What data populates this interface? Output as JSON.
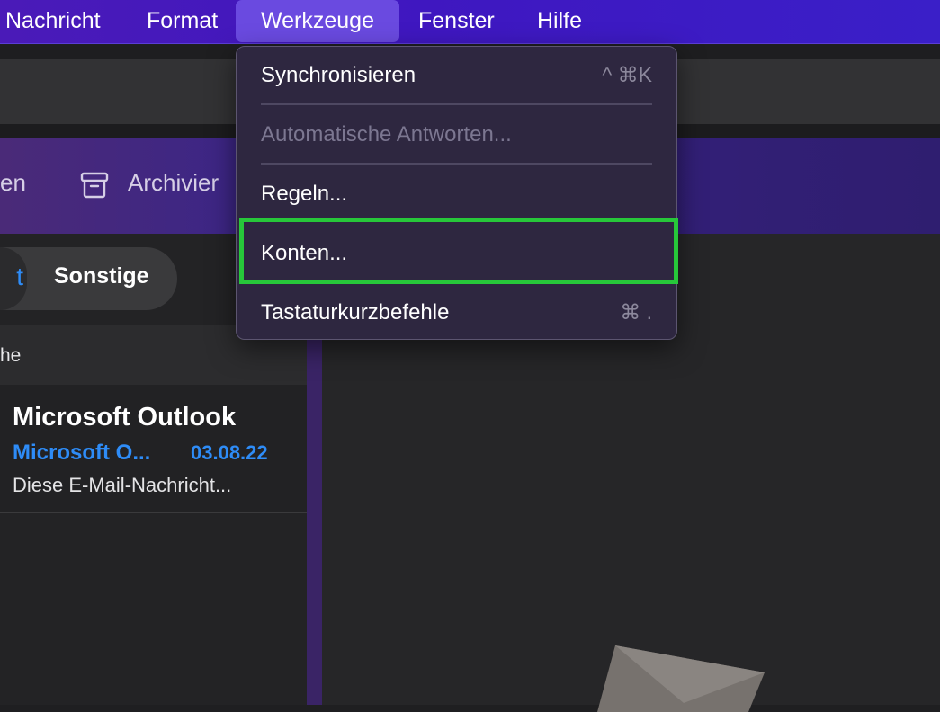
{
  "menubar": {
    "items": [
      {
        "label": "Nachricht"
      },
      {
        "label": "Format"
      },
      {
        "label": "Werkzeuge"
      },
      {
        "label": "Fenster"
      },
      {
        "label": "Hilfe"
      }
    ]
  },
  "ribbon": {
    "left_label": "en",
    "archive_label": "Archivier"
  },
  "filter": {
    "selected_glyph": "t",
    "other_label": "Sonstige"
  },
  "list": {
    "section_label": "he",
    "mail": {
      "sender": "Microsoft Outlook",
      "subject": "Microsoft O...",
      "date": "03.08.22",
      "preview": "Diese E-Mail-Nachricht..."
    }
  },
  "dropdown": {
    "items": [
      {
        "label": "Synchronisieren",
        "shortcut": "^ ⌘K"
      },
      {
        "label": "Automatische Antworten..."
      },
      {
        "label": "Regeln..."
      },
      {
        "label": "Konten..."
      },
      {
        "label": "Tastaturkurzbefehle",
        "shortcut": "⌘ ."
      }
    ]
  },
  "colors": {
    "menubar": "#4318c0",
    "accent_blue": "#2e8cf7",
    "highlight_green": "#27c73a",
    "dropdown_bg": "#2e2740"
  }
}
